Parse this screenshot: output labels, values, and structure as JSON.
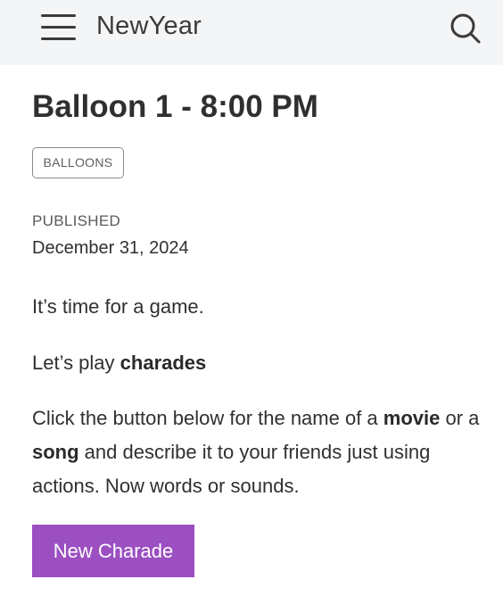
{
  "header": {
    "title": "NewYear",
    "menu_icon": "hamburger-menu-icon",
    "search_icon": "search-icon"
  },
  "post": {
    "title": "Balloon 1 - 8:00 PM",
    "tag": "BALLOONS",
    "published_label": "PUBLISHED",
    "published_date": "December 31, 2024",
    "paragraph1": "It’s time for a game.",
    "paragraph2": {
      "prefix": "Let’s play ",
      "bold": "charades"
    },
    "paragraph3": {
      "part1": "Click the button below for the name of a ",
      "bold1": "movie",
      "part2": " or a ",
      "bold2": "song",
      "part3": " and describe it to your friends just using actions. Now words or sounds."
    },
    "button_label": "New Charade"
  },
  "colors": {
    "header_bg": "#f4f5f6",
    "button_bg": "#9b4fc1",
    "button_text": "#ffffff"
  }
}
